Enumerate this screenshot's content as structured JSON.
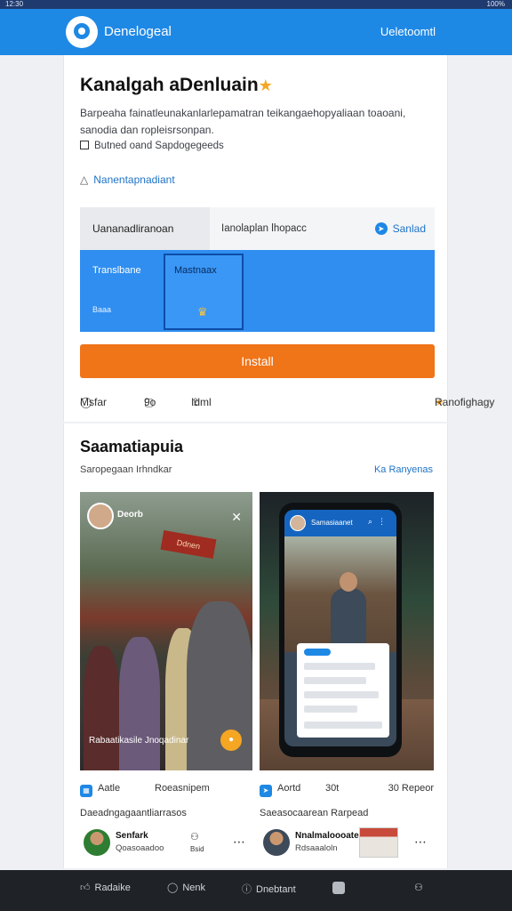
{
  "status_bar": {
    "time": "12:30",
    "icons": "✈ ▾ ▮",
    "battery": "100%"
  },
  "app_bar": {
    "title": "Denelogeal",
    "action": "Ueletoomtl",
    "logo_icon": "chat-bubble-icon",
    "color": "#1e88e5"
  },
  "app": {
    "name": "Kanalgah aDenluain",
    "description": "Barpeaha fainatleunakanlarlepamatran teikangaehopyaliaan toaoani, sanodia dan ropleisrsonpan.",
    "meta": "Butned oand Sapdogegeeds",
    "developer": "Nanentapnadiant"
  },
  "tabs": {
    "tab1": "Uananadliranoan",
    "tab2": "Ianolaplan lhopacc",
    "tab3": "Sanlad"
  },
  "panel": {
    "label_left": "Translbane",
    "label_left_small": "Baaa",
    "selected_label": "Mastnaax"
  },
  "install_button": {
    "label": "Install",
    "color": "#f07418"
  },
  "actions": {
    "a1": "Msfar",
    "a2": "9o",
    "a3": "Idml",
    "a4": "Ranofighagy"
  },
  "screenshots": {
    "title": "Saamatiapuia",
    "subtitle": "Saropegaan Irhndkar",
    "link": "Ka Ranyenas",
    "shot1": {
      "title": "Deorb",
      "banner": "Ddnen",
      "caption": "Rabaatikasile Jnoqadinar"
    },
    "shot2": {
      "title": "Samasiaanet"
    },
    "labels1": {
      "left": "Aatle",
      "right": "Roeasnipem"
    },
    "labels2": {
      "left": "Aortd",
      "mid": "30t",
      "right": "30 Repeor"
    },
    "caption1": "Daeadngagaantliarrasos",
    "caption2": "Saeasocaarean Rarpead"
  },
  "reviews": {
    "r1": {
      "name": "Senfark",
      "sub": "Qoasoaadoo",
      "extra": "Bsid"
    },
    "r2": {
      "name": "Nnalmaloooate",
      "sub": "Rdsaaaloln"
    }
  },
  "bottom_nav": {
    "b1": "Radaike",
    "b2": "Nenk",
    "b3": "Dnebtant"
  }
}
